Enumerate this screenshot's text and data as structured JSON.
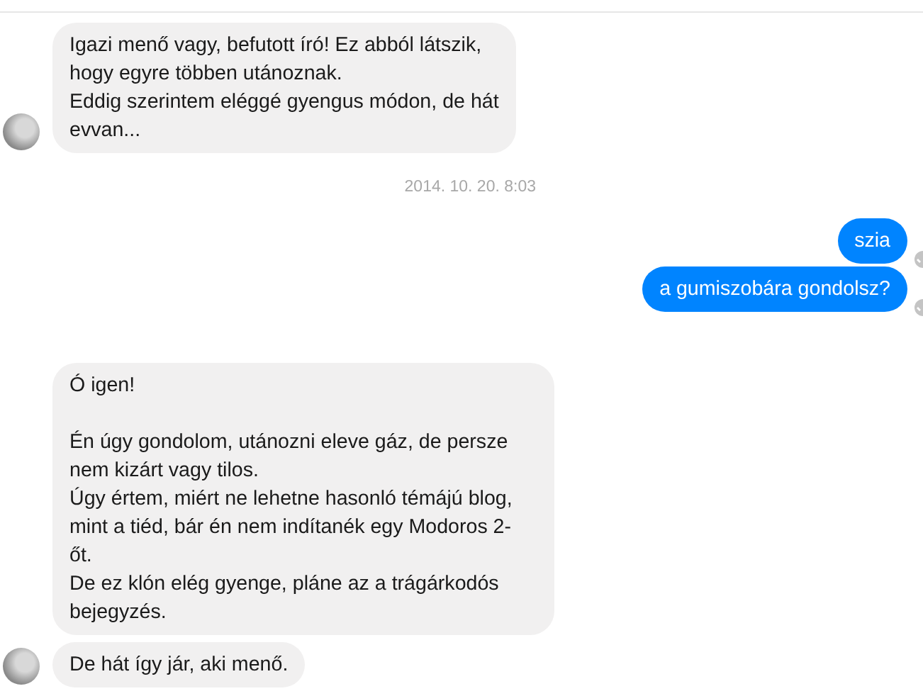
{
  "conversation": [
    {
      "kind": "incoming",
      "bubbles": [
        "Igazi menő vagy, befutott író! Ez abból látszik,\nhogy egyre többen utánoznak.\nEddig szerintem eléggé gyengus módon, de hát\nevvan..."
      ]
    },
    {
      "kind": "timestamp",
      "text": "2014. 10. 20. 8:03"
    },
    {
      "kind": "outgoing",
      "bubbles": [
        "szia",
        "a gumiszobára gondolsz?"
      ]
    },
    {
      "kind": "incoming",
      "bubbles": [
        "Ó igen!\n\nÉn úgy gondolom, utánozni eleve gáz, de persze\nnem kizárt vagy tilos.\nÚgy értem, miért ne lehetne hasonló témájú blog,\nmint a tiéd, bár én nem indítanék egy Modoros 2-\nőt.\nDe ez klón elég gyenge, pláne az a trágárkodós\nbejegyzés.",
        "De hát így jár, aki menő."
      ]
    }
  ]
}
